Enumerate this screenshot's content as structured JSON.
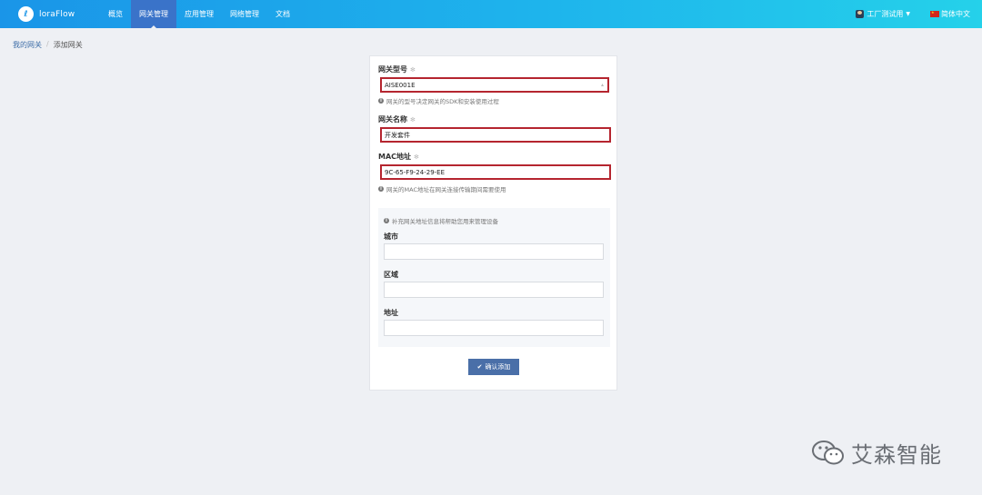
{
  "navbar": {
    "logo_text": "loraFlow",
    "items": [
      {
        "label": "概览",
        "active": false
      },
      {
        "label": "网关管理",
        "active": true
      },
      {
        "label": "应用管理",
        "active": false
      },
      {
        "label": "网络管理",
        "active": false
      },
      {
        "label": "文档",
        "active": false
      }
    ],
    "user_label": "工厂测试用",
    "language_label": "简体中文"
  },
  "breadcrumb": {
    "parent": "我的网关",
    "separator": "/",
    "current": "添加网关"
  },
  "form": {
    "gateway_model": {
      "label": "网关型号",
      "value": "AISE001E",
      "hint": "网关的型号决定网关的SDK和安装使用过程"
    },
    "gateway_name": {
      "label": "网关名称",
      "value": "开发套件"
    },
    "mac_address": {
      "label": "MAC地址",
      "value": "9C-65-F9-24-29-EE",
      "hint": "网关的MAC地址在网关连接传输期间需要使用"
    },
    "required_mark": "✻",
    "address_section": {
      "hint": "补充网关地址信息将帮助您用来管理设备",
      "city_label": "城市",
      "region_label": "区域",
      "address_label": "地址"
    },
    "submit_label": "确认添加"
  },
  "watermark": {
    "text": "艾森智能"
  },
  "colors": {
    "navbar_start": "#1a95e8",
    "navbar_end": "#25d1ea",
    "active_nav": "#3a73c9",
    "error_border": "#b5252f",
    "button": "#4a6fa8"
  }
}
